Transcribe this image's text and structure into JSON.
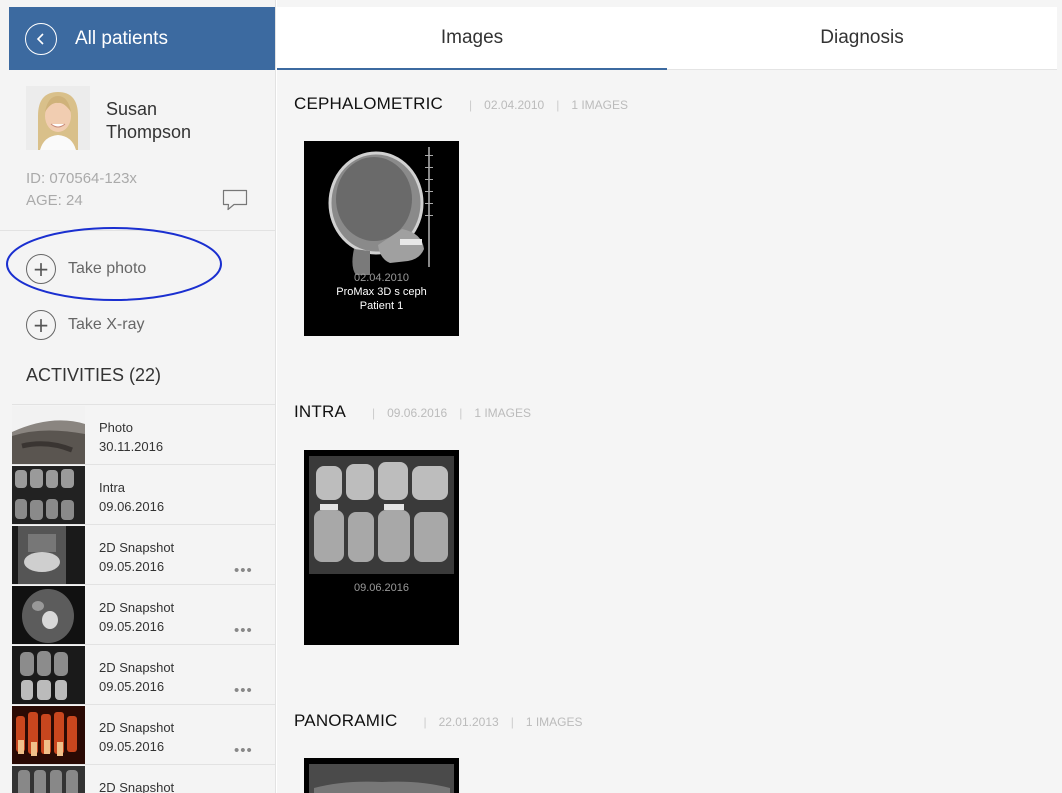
{
  "sidebar": {
    "back_label": "All patients",
    "patient": {
      "name": "Susan Thompson",
      "id": "ID: 070564-123x",
      "age": "AGE: 24"
    },
    "actions": [
      {
        "label": "Take photo"
      },
      {
        "label": "Take X-ray"
      }
    ],
    "activities_title": "ACTIVITIES (22)",
    "activities": [
      {
        "type": "Photo",
        "date": "30.11.2016",
        "has_menu": false
      },
      {
        "type": "Intra",
        "date": "09.06.2016",
        "has_menu": false
      },
      {
        "type": "2D Snapshot",
        "date": "09.05.2016",
        "has_menu": true
      },
      {
        "type": "2D Snapshot",
        "date": "09.05.2016",
        "has_menu": true
      },
      {
        "type": "2D Snapshot",
        "date": "09.05.2016",
        "has_menu": true
      },
      {
        "type": "2D Snapshot",
        "date": "09.05.2016",
        "has_menu": true
      },
      {
        "type": "2D Snapshot",
        "date": "",
        "has_menu": false
      }
    ],
    "more_glyph": "•••"
  },
  "tabs": [
    {
      "label": "Images",
      "active": true
    },
    {
      "label": "Diagnosis",
      "active": false
    }
  ],
  "groups": [
    {
      "title": "CEPHALOMETRIC",
      "date": "02.04.2010",
      "count": "1 IMAGES",
      "cards": [
        {
          "date": "02.04.2010",
          "lines": [
            "ProMax 3D s ceph",
            "Patient 1"
          ]
        }
      ]
    },
    {
      "title": "INTRA",
      "date": "09.06.2016",
      "count": "1 IMAGES",
      "cards": [
        {
          "date": "09.06.2016",
          "lines": []
        }
      ]
    },
    {
      "title": "PANORAMIC",
      "date": "22.01.2013",
      "count": "1 IMAGES",
      "cards": []
    }
  ],
  "separator": "|",
  "colors": {
    "accent": "#3c6aa0",
    "highlight_ellipse": "#1a2fd0",
    "sidebar_bg": "#f4f4f4",
    "main_bg": "#f5f5f5"
  },
  "icons": [
    "chevron-left-icon",
    "comment-icon",
    "plus-icon",
    "more-icon"
  ]
}
